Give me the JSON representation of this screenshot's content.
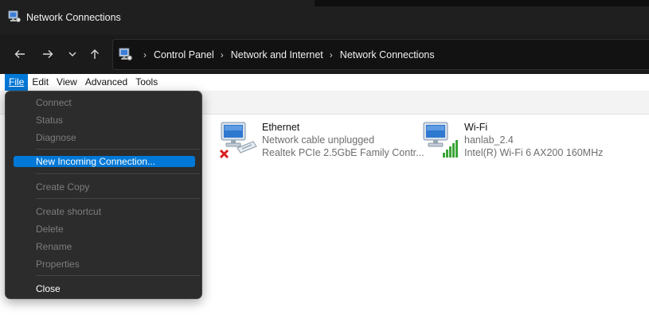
{
  "window": {
    "title": "Network Connections"
  },
  "nav": {
    "back_icon": "back-arrow-icon",
    "forward_icon": "forward-arrow-icon",
    "recent_icon": "chevron-down-icon",
    "up_icon": "up-arrow-icon"
  },
  "address": {
    "crumbs": [
      "Control Panel",
      "Network and Internet",
      "Network Connections"
    ]
  },
  "menubar": {
    "file": "File",
    "edit": "Edit",
    "view": "View",
    "advanced": "Advanced",
    "tools": "Tools"
  },
  "file_menu": {
    "connect": "Connect",
    "status": "Status",
    "diagnose": "Diagnose",
    "new_incoming": "New Incoming Connection...",
    "create_copy": "Create Copy",
    "create_shortcut": "Create shortcut",
    "delete": "Delete",
    "rename": "Rename",
    "properties": "Properties",
    "close": "Close"
  },
  "connections": [
    {
      "name": "Ethernet",
      "status": "Network cable unplugged",
      "device": "Realtek PCIe 2.5GbE Family Contr...",
      "icon": "ethernet-disconnected-icon"
    },
    {
      "name": "Wi-Fi",
      "status": "hanlab_2.4",
      "device": "Intel(R) Wi-Fi 6 AX200 160MHz",
      "icon": "wifi-connected-icon"
    }
  ],
  "colors": {
    "accent": "#0078d7",
    "titlebar": "#1f1f1f",
    "menu_bg": "#2c2c2c"
  }
}
